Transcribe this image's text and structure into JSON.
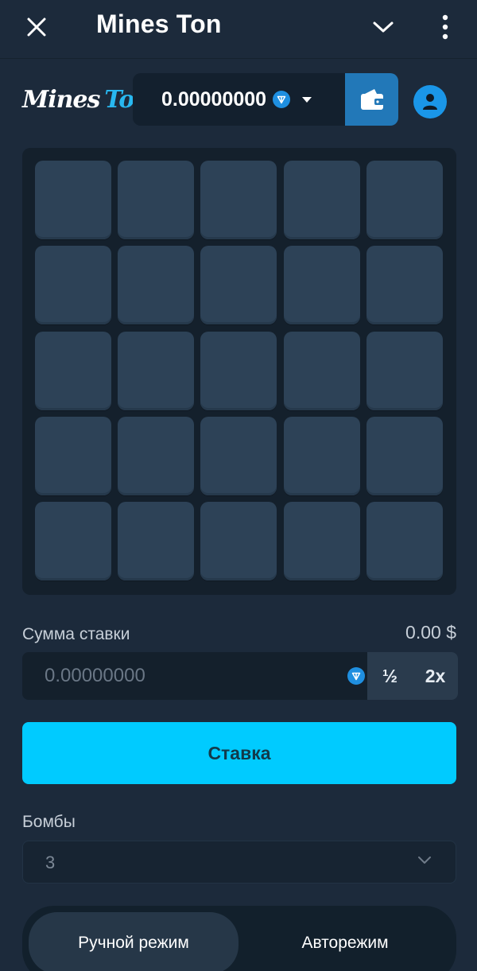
{
  "topbar": {
    "title": "Mines Ton",
    "icons": {
      "close": "close-icon",
      "collapse": "chevron-down-icon",
      "more": "more-vertical-icon"
    }
  },
  "header": {
    "logo": {
      "word1": "Mines",
      "word2": "Ton"
    },
    "balance": {
      "amount": "0.00000000",
      "currency_icon": "ton-icon"
    },
    "icons": {
      "dropdown": "caret-down-icon",
      "wallet": "wallet-icon",
      "account": "user-icon"
    }
  },
  "game": {
    "grid": {
      "rows": 5,
      "cols": 5
    }
  },
  "bet": {
    "label": "Сумма ставки",
    "usd_value": "0.00 $",
    "input_value": "0.00000000",
    "half_label": "½",
    "double_label": "2x"
  },
  "stake_button": {
    "label": "Ставка"
  },
  "bombs": {
    "label": "Бомбы",
    "selected": "3"
  },
  "mode": {
    "tabs": [
      {
        "label": "Ручной режим",
        "active": true
      },
      {
        "label": "Авторежим",
        "active": false
      }
    ]
  },
  "colors": {
    "background": "#1c2a3b",
    "accent": "#00cbff",
    "tile": "#2d4257",
    "wallet": "#2278b8",
    "ton": "#1f8fe0"
  }
}
